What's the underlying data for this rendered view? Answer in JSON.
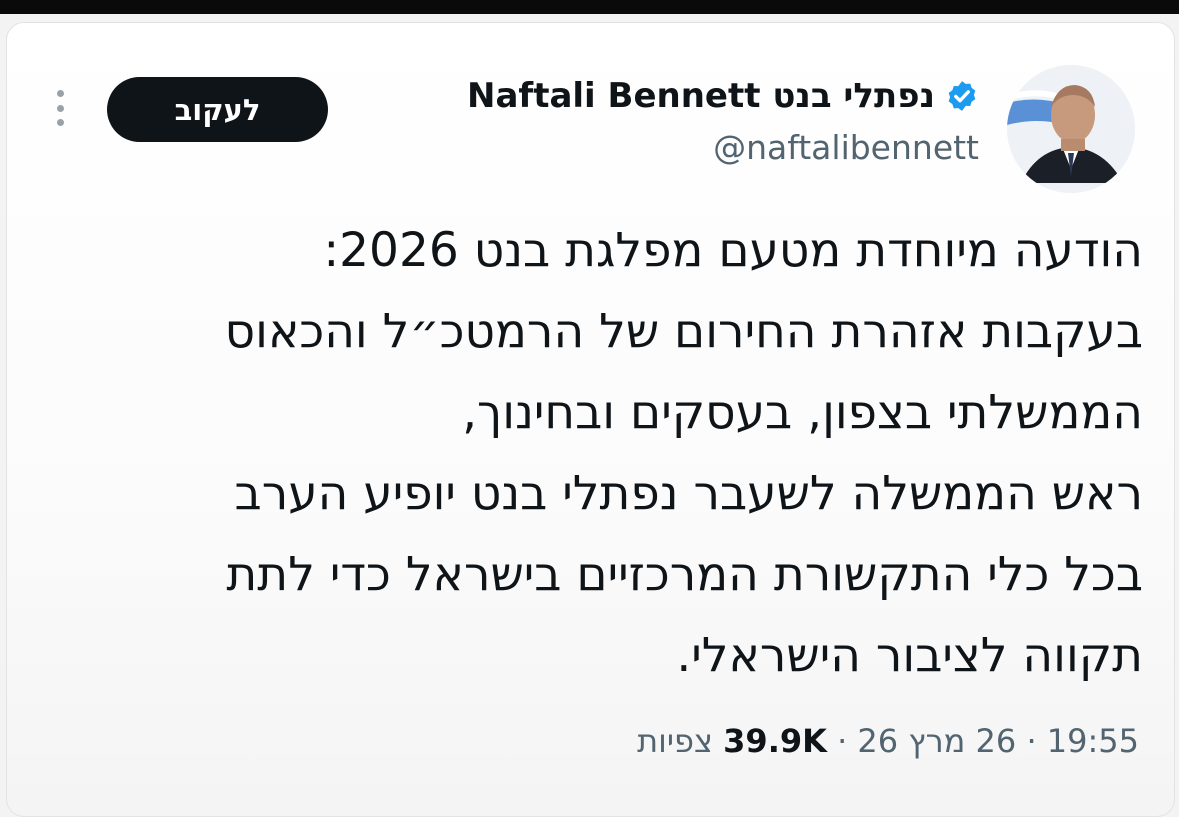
{
  "header": {
    "display_name": "Naftali Bennett נפתלי בנט",
    "handle": "@naftalibennett",
    "follow_label": "לעקוב",
    "more_icon": "more-vertical-icon",
    "verified_icon": "verified-badge-icon",
    "avatar": "avatar"
  },
  "tweet": {
    "lines": [
      "הודעה מיוחדת מטעם מפלגת בנט 2026:",
      "בעקבות אזהרת החירום של  הרמטכ״ל והכאוס",
      "הממשלתי בצפון, בעסקים ובחינוך,",
      "ראש הממשלה לשעבר נפתלי בנט יופיע הערב",
      "בכל כלי התקשורת המרכזיים בישראל כדי לתת",
      "תקווה לציבור הישראלי."
    ]
  },
  "meta": {
    "time": "19:55",
    "separator": "·",
    "date": "26 מרץ 26",
    "views_count": "39.9K",
    "views_label": "צפיות"
  },
  "colors": {
    "text": "#0f1419",
    "secondary": "#536471",
    "verified": "#1d9bf0",
    "button_bg": "#0f1419"
  }
}
